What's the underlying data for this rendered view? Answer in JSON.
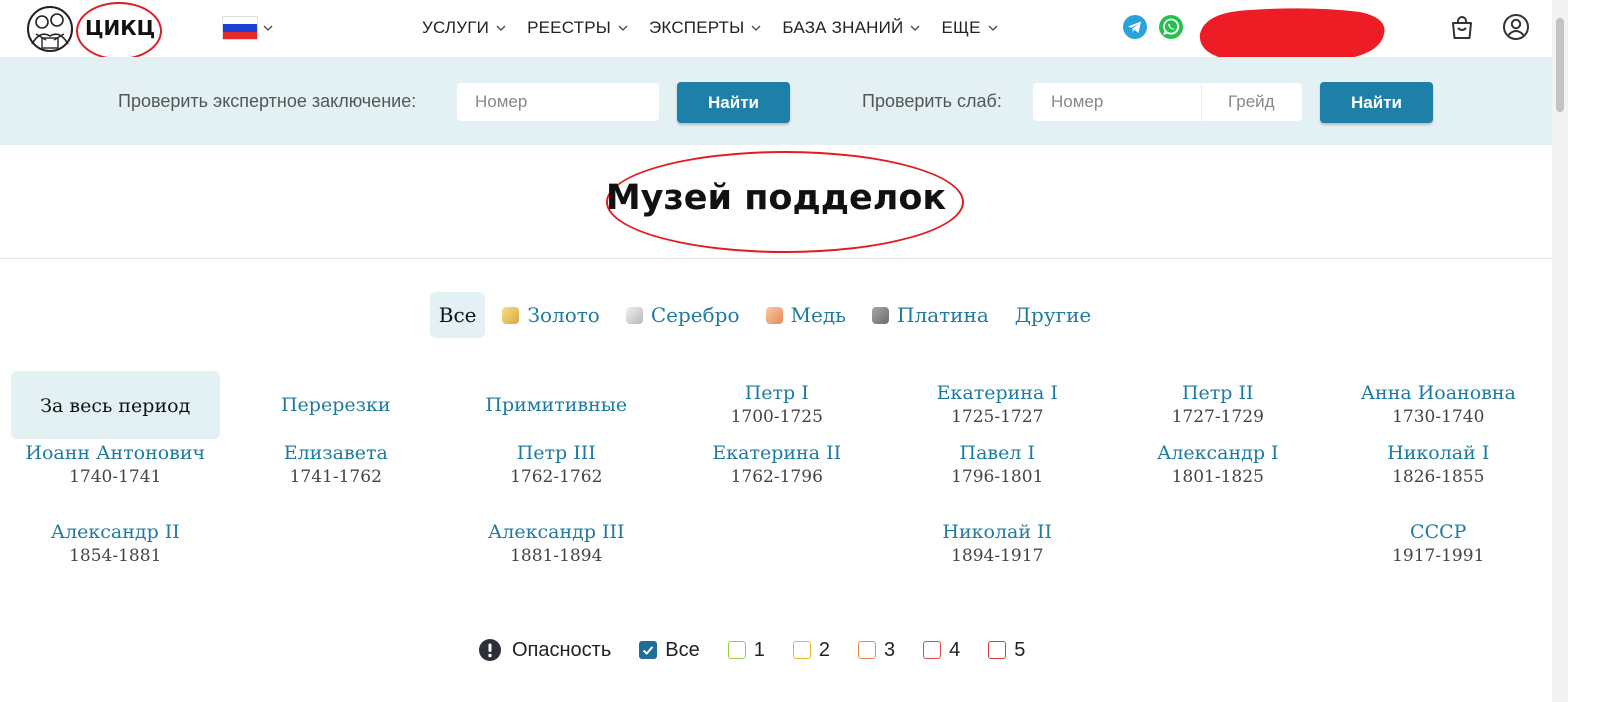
{
  "header": {
    "logo_text": "ЦИКЦ",
    "nav": [
      {
        "label": "УСЛУГИ"
      },
      {
        "label": "РЕЕСТРЫ"
      },
      {
        "label": "ЭКСПЕРТЫ"
      },
      {
        "label": "БАЗА ЗНАНИЙ"
      },
      {
        "label": "ЕЩЕ"
      }
    ],
    "icons": [
      "telegram-icon",
      "whatsapp-icon",
      "cart-icon",
      "account-icon"
    ]
  },
  "search": {
    "expert_label": "Проверить экспертное заключение:",
    "expert_placeholder": "Номер",
    "expert_button": "Найти",
    "slab_label": "Проверить слаб:",
    "slab_number_placeholder": "Номер",
    "slab_grade_placeholder": "Грейд",
    "slab_button": "Найти"
  },
  "page_title": "Музей подделок",
  "metals": [
    {
      "label": "Все",
      "active": true
    },
    {
      "label": "Золото",
      "color": "#e8c15a"
    },
    {
      "label": "Серебро",
      "color": "#cfcfcf"
    },
    {
      "label": "Медь",
      "color": "#f0a070"
    },
    {
      "label": "Платина",
      "color": "#8a8a8a"
    },
    {
      "label": "Другие"
    }
  ],
  "periods": [
    {
      "name": "За весь период",
      "years": ""
    },
    {
      "name": "Перерезки",
      "years": ""
    },
    {
      "name": "Примитивные",
      "years": ""
    },
    {
      "name": "Петр I",
      "years": "1700-1725"
    },
    {
      "name": "Екатерина I",
      "years": "1725-1727"
    },
    {
      "name": "Петр II",
      "years": "1727-1729"
    },
    {
      "name": "Анна Иоановна",
      "years": "1730-1740"
    },
    {
      "name": "Иоанн Антонович",
      "years": "1740-1741"
    },
    {
      "name": "Елизавета",
      "years": "1741-1762"
    },
    {
      "name": "Петр III",
      "years": "1762-1762"
    },
    {
      "name": "Екатерина II",
      "years": "1762-1796"
    },
    {
      "name": "Павел I",
      "years": "1796-1801"
    },
    {
      "name": "Александр I",
      "years": "1801-1825"
    },
    {
      "name": "Николай I",
      "years": "1826-1855"
    },
    {
      "name": "Александр II",
      "years": "1854-1881"
    },
    {
      "name": "Александр III",
      "years": "1881-1894"
    },
    {
      "name": "Николай II",
      "years": "1894-1917"
    },
    {
      "name": "СССР",
      "years": "1917-1991"
    }
  ],
  "danger": {
    "label": "Опасность",
    "options": [
      {
        "label": "Все",
        "checked": true,
        "color": "#1e6f96"
      },
      {
        "label": "1",
        "checked": false,
        "color": "#9ccc45"
      },
      {
        "label": "2",
        "checked": false,
        "color": "#e8b82a"
      },
      {
        "label": "3",
        "checked": false,
        "color": "#f08a4b"
      },
      {
        "label": "4",
        "checked": false,
        "color": "#e04848"
      },
      {
        "label": "5",
        "checked": false,
        "color": "#d93a3a"
      }
    ]
  },
  "colors": {
    "accent": "#1e7fa8",
    "link": "#1f7aa0",
    "band": "#e3f0f4",
    "annotation_red": "#e01b24"
  }
}
